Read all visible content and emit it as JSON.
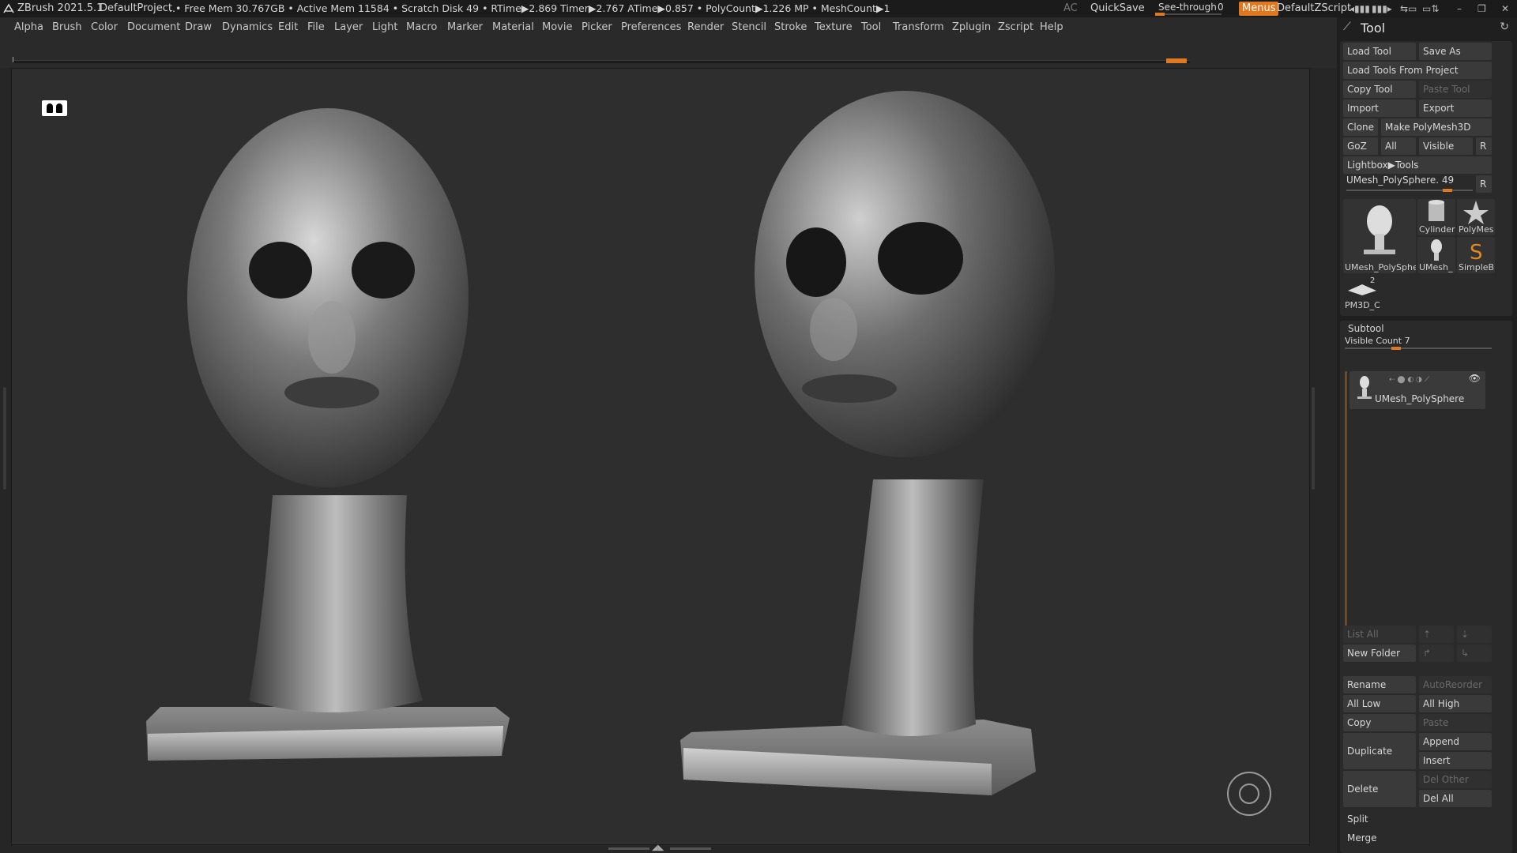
{
  "titlebar": {
    "app": "ZBrush 2021.5.1",
    "project": "DefaultProject",
    "stats": "..• Free Mem 30.767GB • Active Mem 11584 • Scratch Disk 49 • RTime▶2.869 Timer▶2.767 ATime▶0.857 • PolyCount▶1.226 MP • MeshCount▶1",
    "ac": "AC",
    "quicksave": "QuickSave",
    "seethrough": "See-through",
    "seethrough_value": "0",
    "seethrough_level": 0,
    "menus": "Menus",
    "script": "DefaultZScript"
  },
  "menubar": [
    "Alpha",
    "Brush",
    "Color",
    "Document",
    "Draw",
    "Dynamics",
    "Edit",
    "File",
    "Layer",
    "Light",
    "Macro",
    "Marker",
    "Material",
    "Movie",
    "Picker",
    "Preferences",
    "Render",
    "Stencil",
    "Stroke",
    "Texture",
    "Tool",
    "Transform",
    "Zplugin",
    "Zscript",
    "Help"
  ],
  "panel": {
    "title": "Tool",
    "load_tool": "Load Tool",
    "save_as": "Save As",
    "load_from_project": "Load Tools From Project",
    "copy_tool": "Copy Tool",
    "paste_tool": "Paste Tool",
    "import": "Import",
    "export": "Export",
    "clone": "Clone",
    "make_polymesh": "Make PolyMesh3D",
    "goz": "GoZ",
    "all": "All",
    "visible": "Visible",
    "r": "R",
    "lightbox_tools": "Lightbox▶Tools",
    "current_tool": "UMesh_PolySphere. 49",
    "tool_slider_level": 0.8,
    "thumbs": [
      {
        "name": "UMesh_PolySphe"
      },
      {
        "name": "Cylinder"
      },
      {
        "name": "PolyMes"
      },
      {
        "name": "UMesh_"
      },
      {
        "name": "SimpleB"
      },
      {
        "name": "PM3D_C",
        "badge": "2"
      }
    ],
    "subtool": {
      "title": "Subtool",
      "visible_count": "Visible Count 7",
      "visible_count_level": 0.35,
      "item": "UMesh_PolySphere",
      "list_all": "List All",
      "new_folder": "New Folder",
      "rename": "Rename",
      "autoreorder": "AutoReorder",
      "all_low": "All Low",
      "all_high": "All High",
      "copy": "Copy",
      "paste": "Paste",
      "duplicate": "Duplicate",
      "append": "Append",
      "insert": "Insert",
      "delete": "Delete",
      "del_other": "Del Other",
      "del_all": "Del All",
      "split": "Split",
      "merge": "Merge"
    }
  },
  "colors": {
    "accent": "#e07820",
    "bg": "#262626",
    "panel": "#1f1f1f",
    "button": "#3a3a3a"
  },
  "icons": [
    "zbrush-logo-icon",
    "floor-view-icon",
    "navigation-circle-icon",
    "pin-icon",
    "rotate-icon",
    "eye-icon"
  ]
}
